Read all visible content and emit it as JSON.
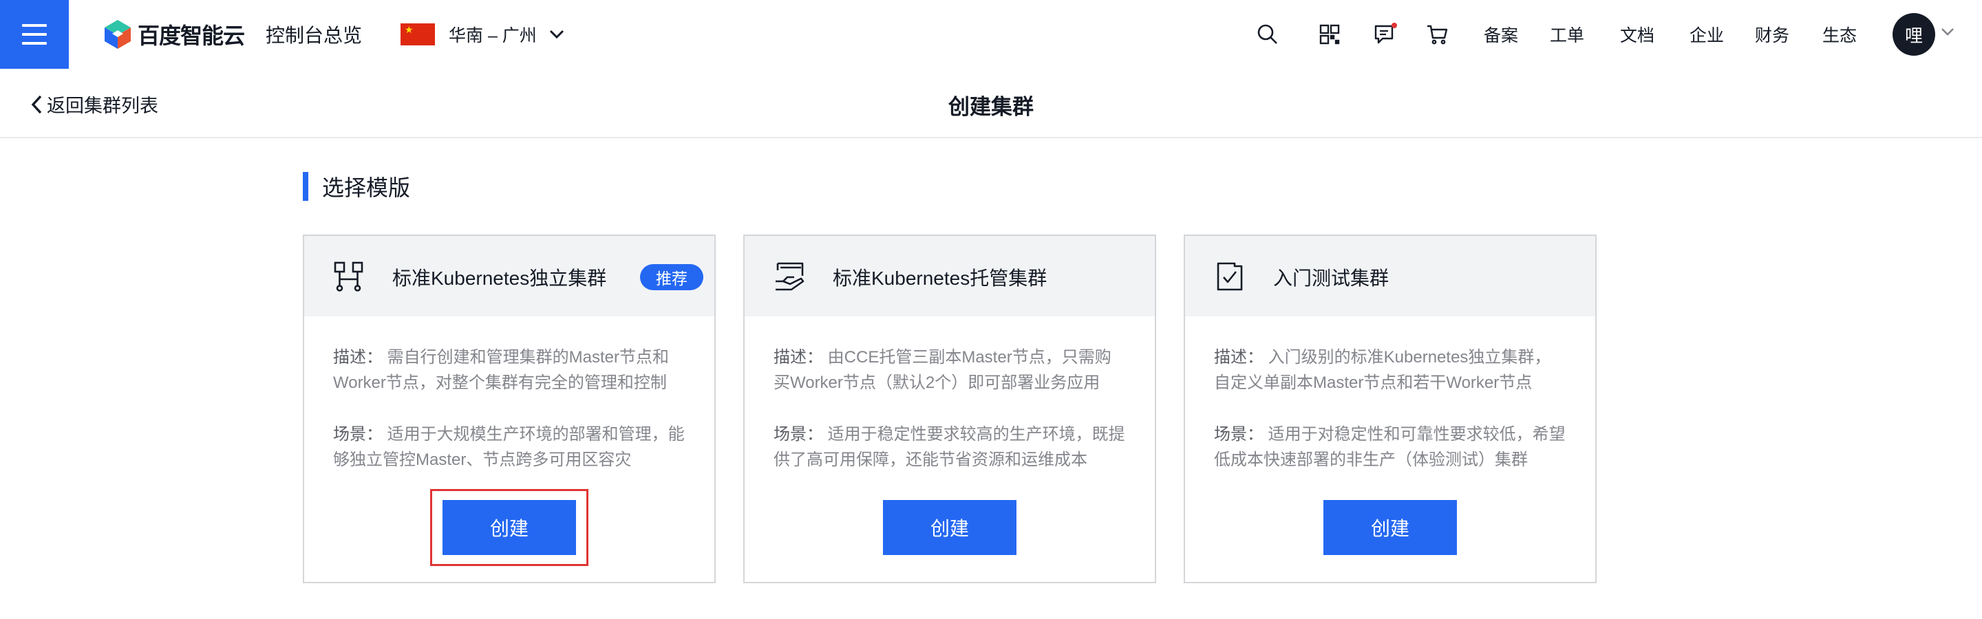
{
  "topbar": {
    "menu_icon": "hamburger-menu-icon",
    "logo_text": "百度智能云",
    "console_overview": "控制台总览",
    "region": "华南 – 广州",
    "links": [
      "备案",
      "工单",
      "文档",
      "企业",
      "财务",
      "生态"
    ],
    "icons": [
      "search-icon",
      "qrcode-icon",
      "message-icon",
      "cart-icon"
    ],
    "avatar_text": "哩",
    "accent_color": "#2468f2",
    "notification_color": "#e03434"
  },
  "subheader": {
    "back_label": "返回集群列表",
    "title": "创建集群"
  },
  "section": {
    "title": "选择模版"
  },
  "cards": [
    {
      "name": "标准Kubernetes独立集群",
      "badge": "推荐",
      "desc_label": "描述：",
      "desc_line1": "需自行创建和管理集群的Master节点和",
      "desc_line2": "Worker节点，对整个集群有完全的管理和控制",
      "scene_label": "场景：",
      "scene_line1": "适用于大规模生产环境的部署和管理，能",
      "scene_line2": "够独立管控Master、节点跨多可用区容灾",
      "button": "创建",
      "icon": "cluster-nodes-icon"
    },
    {
      "name": "标准Kubernetes托管集群",
      "desc_label": "描述：",
      "desc_line1": "由CCE托管三副本Master节点，只需购",
      "desc_line2": "买Worker节点（默认2个）即可部署业务应用",
      "scene_label": "场景：",
      "scene_line1": "适用于稳定性要求较高的生产环境，既提",
      "scene_line2": "供了高可用保障，还能节省资源和运维成本",
      "button": "创建",
      "icon": "hosted-cluster-icon"
    },
    {
      "name": "入门测试集群",
      "desc_label": "描述：",
      "desc_line1": "入门级别的标准Kubernetes独立集群，",
      "desc_line2": "自定义单副本Master节点和若干Worker节点",
      "scene_label": "场景：",
      "scene_line1": "适用于对稳定性和可靠性要求较低，希望",
      "scene_line2": "低成本快速部署的非生产（体验测试）集群",
      "button": "创建",
      "icon": "checklist-icon"
    }
  ]
}
